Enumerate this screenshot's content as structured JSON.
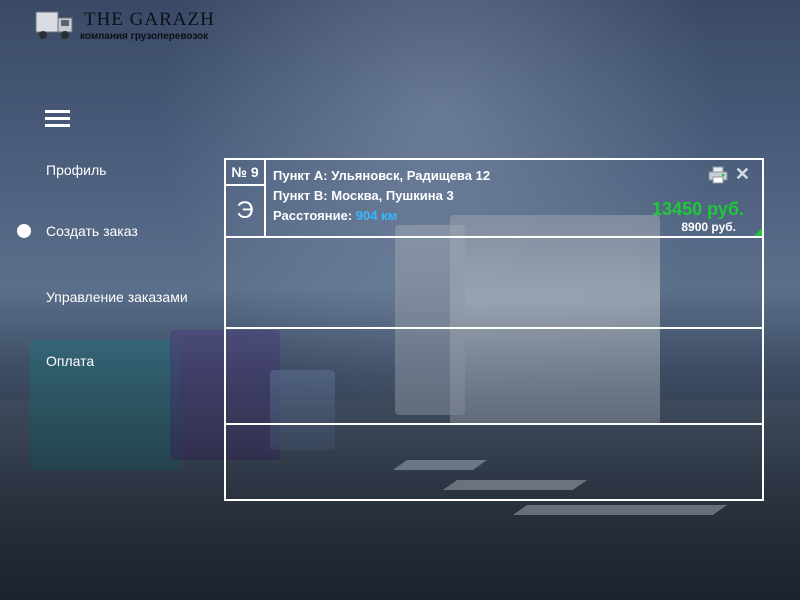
{
  "logo": {
    "title": "THE  GARAZH",
    "subtitle": "компания грузоперевозок"
  },
  "nav": {
    "items": [
      {
        "label": "Профиль"
      },
      {
        "label": "Создать заказ"
      },
      {
        "label": "Управление заказами"
      },
      {
        "label": "Оплата"
      }
    ],
    "active_index": 1
  },
  "order": {
    "number": "№ 9",
    "letter": "Э",
    "point_a": "Пункт А: Ульяновск, Радищева 12",
    "point_b": "Пункт В: Москва, Пушкина 3",
    "distance_label": "Расстояние: ",
    "distance_value": "904 км",
    "price_main": "13450 руб.",
    "price_secondary": "8900  руб."
  },
  "colors": {
    "accent_green": "#1ec83a",
    "distance_blue": "#36b8ff"
  },
  "icons": [
    "truck-logo-icon",
    "menu-icon",
    "printer-icon",
    "close-icon"
  ]
}
